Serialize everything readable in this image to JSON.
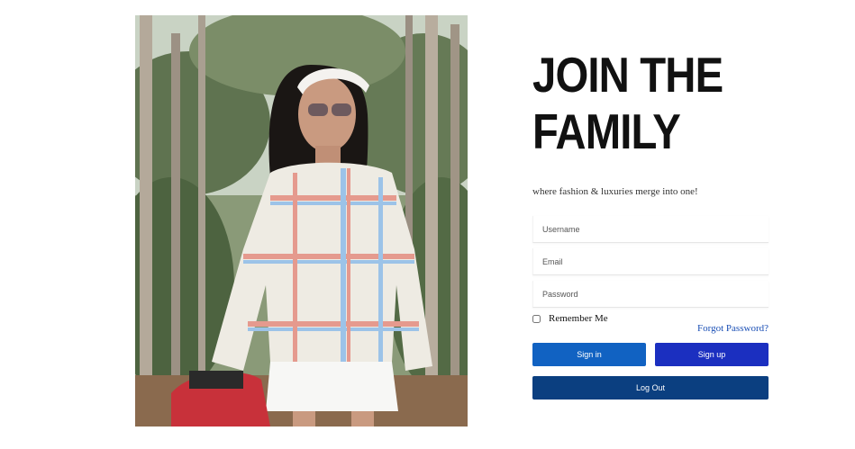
{
  "hero": {
    "title_line1": "JOIN THE",
    "title_line2": "FAMILY",
    "tagline": "where fashion & luxuries merge into one!"
  },
  "photo": {
    "description_icon": "fashion-model-photo"
  },
  "form": {
    "username_placeholder": "Username",
    "email_placeholder": "Email",
    "password_placeholder": "Password",
    "remember_label": "Remember Me",
    "remember_checked": false,
    "forgot_label": "Forgot Password?"
  },
  "buttons": {
    "signin_label": "Sign in",
    "signup_label": "Sign up",
    "logout_label": "Log Out"
  },
  "colors": {
    "signin": "#1162c2",
    "signup": "#1b2fc0",
    "logout": "#0b3f80",
    "link": "#1a4fb5"
  }
}
